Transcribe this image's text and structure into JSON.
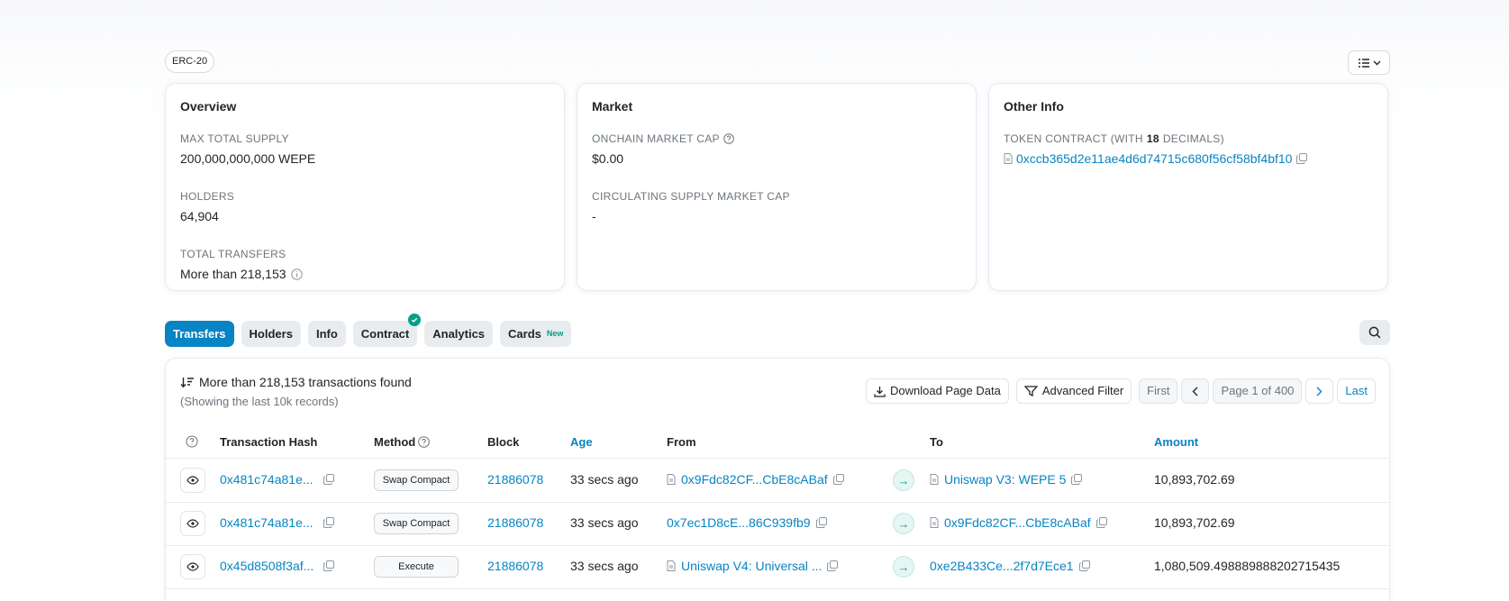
{
  "token_standard": "ERC-20",
  "overview": {
    "title": "Overview",
    "max_supply_label": "MAX TOTAL SUPPLY",
    "max_supply_value": "200,000,000,000 WEPE",
    "holders_label": "HOLDERS",
    "holders_value": "64,904",
    "transfers_label": "TOTAL TRANSFERS",
    "transfers_value": "More than 218,153"
  },
  "market": {
    "title": "Market",
    "onchain_cap_label": "ONCHAIN MARKET CAP",
    "onchain_cap_value": "$0.00",
    "circ_cap_label": "CIRCULATING SUPPLY MARKET CAP",
    "circ_cap_value": "-"
  },
  "other_info": {
    "title": "Other Info",
    "contract_label_prefix": "TOKEN CONTRACT (WITH",
    "contract_decimals": "18",
    "contract_label_suffix": "DECIMALS)",
    "contract_address": "0xccb365d2e11ae4d6d74715c680f56cf58bf4bf10"
  },
  "tabs": [
    {
      "label": "Transfers",
      "active": true
    },
    {
      "label": "Holders"
    },
    {
      "label": "Info"
    },
    {
      "label": "Contract",
      "verified": true
    },
    {
      "label": "Analytics"
    },
    {
      "label": "Cards",
      "badge": "New"
    }
  ],
  "table": {
    "found_text": "More than 218,153 transactions found",
    "found_sub": "(Showing the last 10k records)",
    "download_label": "Download Page Data",
    "filter_label": "Advanced Filter",
    "first_label": "First",
    "page_label": "Page 1 of 400",
    "last_label": "Last",
    "headers": {
      "hash": "Transaction Hash",
      "method": "Method",
      "block": "Block",
      "age": "Age",
      "from": "From",
      "to": "To",
      "amount": "Amount"
    },
    "rows": [
      {
        "hash": "0x481c74a81e...",
        "method": "Swap Compact",
        "block": "21886078",
        "age": "33 secs ago",
        "from": "0x9Fdc82CF...CbE8cABaf",
        "from_contract": true,
        "to": "Uniswap V3: WEPE 5",
        "to_contract": true,
        "amount": "10,893,702.69"
      },
      {
        "hash": "0x481c74a81e...",
        "method": "Swap Compact",
        "block": "21886078",
        "age": "33 secs ago",
        "from": "0x7ec1D8cE...86C939fb9",
        "from_contract": false,
        "to": "0x9Fdc82CF...CbE8cABaf",
        "to_contract": true,
        "amount": "10,893,702.69"
      },
      {
        "hash": "0x45d8508f3af...",
        "method": "Execute",
        "block": "21886078",
        "age": "33 secs ago",
        "from": "Uniswap V4: Universal ...",
        "from_contract": true,
        "to": "0xe2B433Ce...2f7d7Ece1",
        "to_contract": false,
        "amount": "1,080,509.498889888202715435"
      }
    ]
  },
  "colors": {
    "primary": "#0784c3",
    "success": "#00a186",
    "text": "#212529",
    "muted": "#6c757d"
  }
}
